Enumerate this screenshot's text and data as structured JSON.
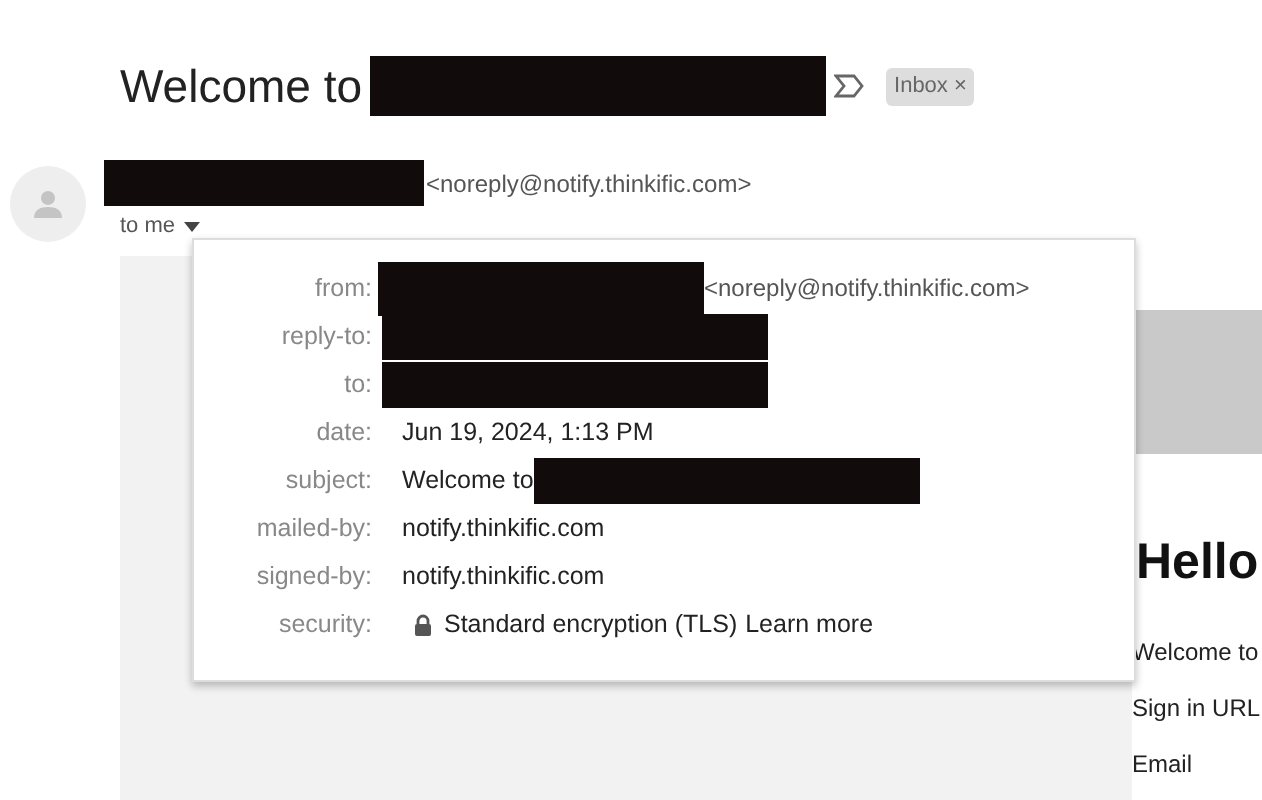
{
  "subject": {
    "prefix": "Welcome to",
    "redacted": true
  },
  "label": {
    "text": "Inbox",
    "close": "×"
  },
  "sender": {
    "redacted": true,
    "email": "<noreply@notify.thinkific.com>",
    "recipient": "to me"
  },
  "details": [
    {
      "label": "from:",
      "kind": "redacted_email",
      "value": "<noreply@notify.thinkific.com>"
    },
    {
      "label": "reply-to:",
      "kind": "redacted"
    },
    {
      "label": "to:",
      "kind": "redacted"
    },
    {
      "label": "date:",
      "kind": "text",
      "value": "Jun 19, 2024, 1:13 PM"
    },
    {
      "label": "subject:",
      "kind": "redacted_text",
      "value": "Welcome to"
    },
    {
      "label": "mailed-by:",
      "kind": "text",
      "value": "notify.thinkific.com"
    },
    {
      "label": "signed-by:",
      "kind": "text",
      "value": "notify.thinkific.com"
    },
    {
      "label": "security:",
      "kind": "security",
      "value": "Standard encryption (TLS)",
      "link": "Learn more"
    }
  ],
  "body": {
    "heading": "Hello",
    "lines": [
      "Welcome to",
      "Sign in URL",
      "Email"
    ]
  }
}
